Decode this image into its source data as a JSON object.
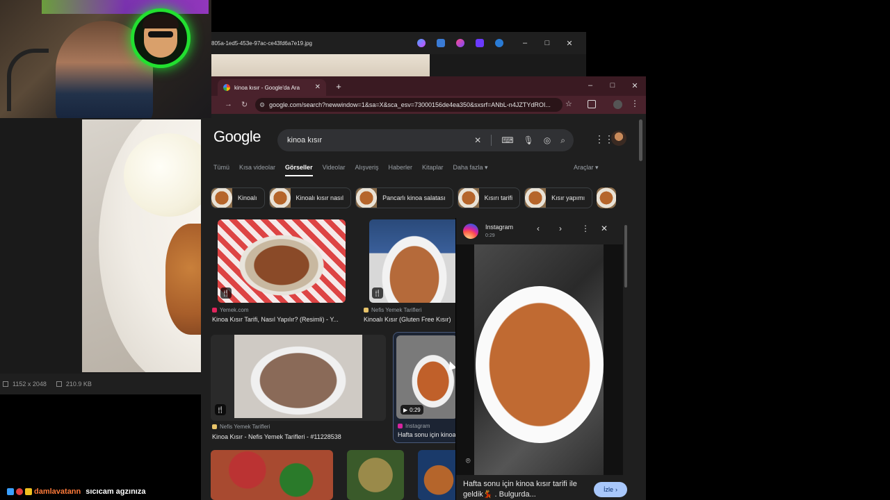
{
  "viewer": {
    "filename": "805a-1ed5-453e-97ac-ce43fd6a7e19.jpg",
    "dimensions": "1152 x 2048",
    "filesize": "210.9 KB",
    "min": "–",
    "max": "□",
    "close": "✕"
  },
  "chrome": {
    "tab_title": "kinoa kısır - Google'da Ara",
    "tab_close": "✕",
    "new_tab": "+",
    "url": "google.com/search?newwindow=1&sa=X&sca_esv=73000156de4ea350&sxsrf=ANbL-n4JZTYdROI...",
    "min": "–",
    "max": "□",
    "close": "✕"
  },
  "google": {
    "logo": "Google",
    "query": "kinoa kısır",
    "tabs": [
      "Tümü",
      "Kısa videolar",
      "Görseller",
      "Videolar",
      "Alışveriş",
      "Haberler",
      "Kitaplar",
      "Daha fazla ▾"
    ],
    "active_tab": "Görseller",
    "tools": "Araçlar ▾",
    "chips": [
      "Kinoalı",
      "Kinoalı kısır nasıl",
      "Pancarlı kinoa salatası",
      "Kısırı tarifi",
      "Kısır yapımı"
    ]
  },
  "results": [
    {
      "source": "Yemek.com",
      "title": "Kinoa Kısır Tarifi, Nasıl Yapılır? (Resimli) - Y..."
    },
    {
      "source": "Nefis Yemek Tarifleri",
      "title": "Kinoalı Kısır (Gluten Free Kısır)"
    },
    {
      "source": "Nefis Yemek Tarifleri",
      "title": "Kinoa Kısır - Nefis Yemek Tarifleri - #11228538"
    },
    {
      "source": "Instagram",
      "title": "Hafta sonu için kinoa",
      "duration": "0:29"
    }
  ],
  "panel": {
    "source": "Instagram",
    "duration": "0:29",
    "caption": "Hafta sonu için kinoa kısır tarifi ile geldik💃 . Bulgurda...",
    "button": "İzle"
  },
  "chat": {
    "user": "damlavatann",
    "message": "sıcıcam agzınıza"
  },
  "colors": {
    "accent_blue": "#a8c7fa",
    "tabstrip": "#3a1a22",
    "page_bg": "#1f1f1f"
  }
}
